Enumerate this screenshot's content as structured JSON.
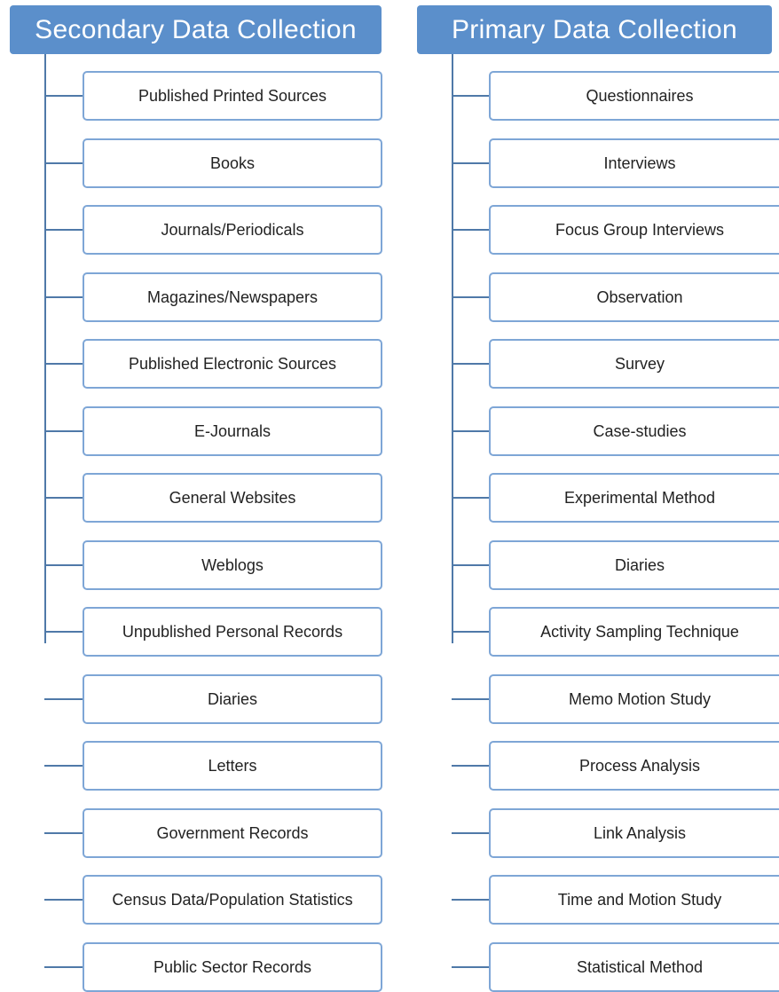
{
  "secondary": {
    "title": "Secondary Data Collection",
    "items": [
      "Published Printed Sources",
      "Books",
      "Journals/Periodicals",
      "Magazines/Newspapers",
      "Published Electronic Sources",
      "E-Journals",
      "General Websites",
      "Weblogs",
      "Unpublished Personal Records",
      "Diaries",
      "Letters",
      "Government Records",
      "Census Data/Population Statistics",
      "Public Sector Records"
    ]
  },
  "primary": {
    "title": "Primary Data Collection",
    "items": [
      "Questionnaires",
      "Interviews",
      "Focus Group Interviews",
      "Observation",
      "Survey",
      "Case-studies",
      "Experimental Method",
      "Diaries",
      "Activity Sampling Technique",
      "Memo Motion Study",
      "Process Analysis",
      "Link Analysis",
      "Time and Motion Study",
      "Statistical Method"
    ]
  },
  "colors": {
    "header_bg": "#5b8fcb",
    "connector": "#4f79a8",
    "box_border": "#7ea6d6"
  }
}
